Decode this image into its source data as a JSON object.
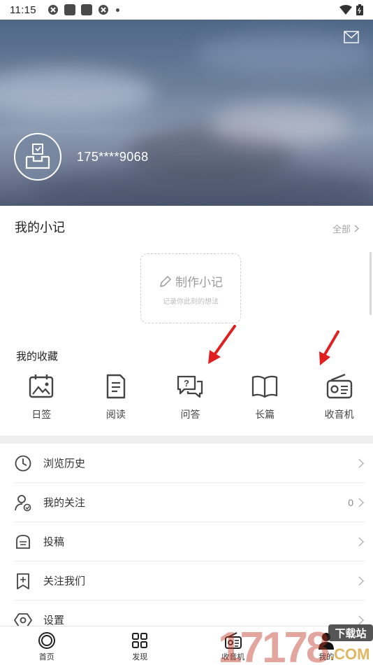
{
  "status_bar": {
    "time": "11:15"
  },
  "profile": {
    "phone": "175****9068"
  },
  "notes": {
    "title": "我的小记",
    "all_label": "全部",
    "make_label": "制作小记",
    "make_hint": "记录你此刻的想法"
  },
  "favorites": {
    "title": "我的收藏",
    "items": [
      {
        "label": "日签",
        "icon": "calendar-image-icon"
      },
      {
        "label": "阅读",
        "icon": "document-icon"
      },
      {
        "label": "问答",
        "icon": "qa-bubble-icon"
      },
      {
        "label": "长篇",
        "icon": "open-book-icon"
      },
      {
        "label": "收音机",
        "icon": "radio-icon"
      }
    ]
  },
  "menu": [
    {
      "label": "浏览历史",
      "icon": "clock-icon",
      "value": ""
    },
    {
      "label": "我的关注",
      "icon": "user-follow-icon",
      "value": "0"
    },
    {
      "label": "投稿",
      "icon": "inbox-icon",
      "value": ""
    },
    {
      "label": "关注我们",
      "icon": "bookmark-plus-icon",
      "value": ""
    },
    {
      "label": "设置",
      "icon": "settings-icon",
      "value": ""
    }
  ],
  "tabs": [
    {
      "label": "首页",
      "icon": "home-circle-icon"
    },
    {
      "label": "发现",
      "icon": "grid-icon"
    },
    {
      "label": "收音机",
      "icon": "radio-icon"
    },
    {
      "label": "我的",
      "icon": "person-icon"
    }
  ],
  "watermark": {
    "text": "17178",
    "sub": "下载站",
    "domain": ".COM"
  },
  "colors": {
    "accent_red": "#e02020",
    "icon_gray": "#444444"
  }
}
